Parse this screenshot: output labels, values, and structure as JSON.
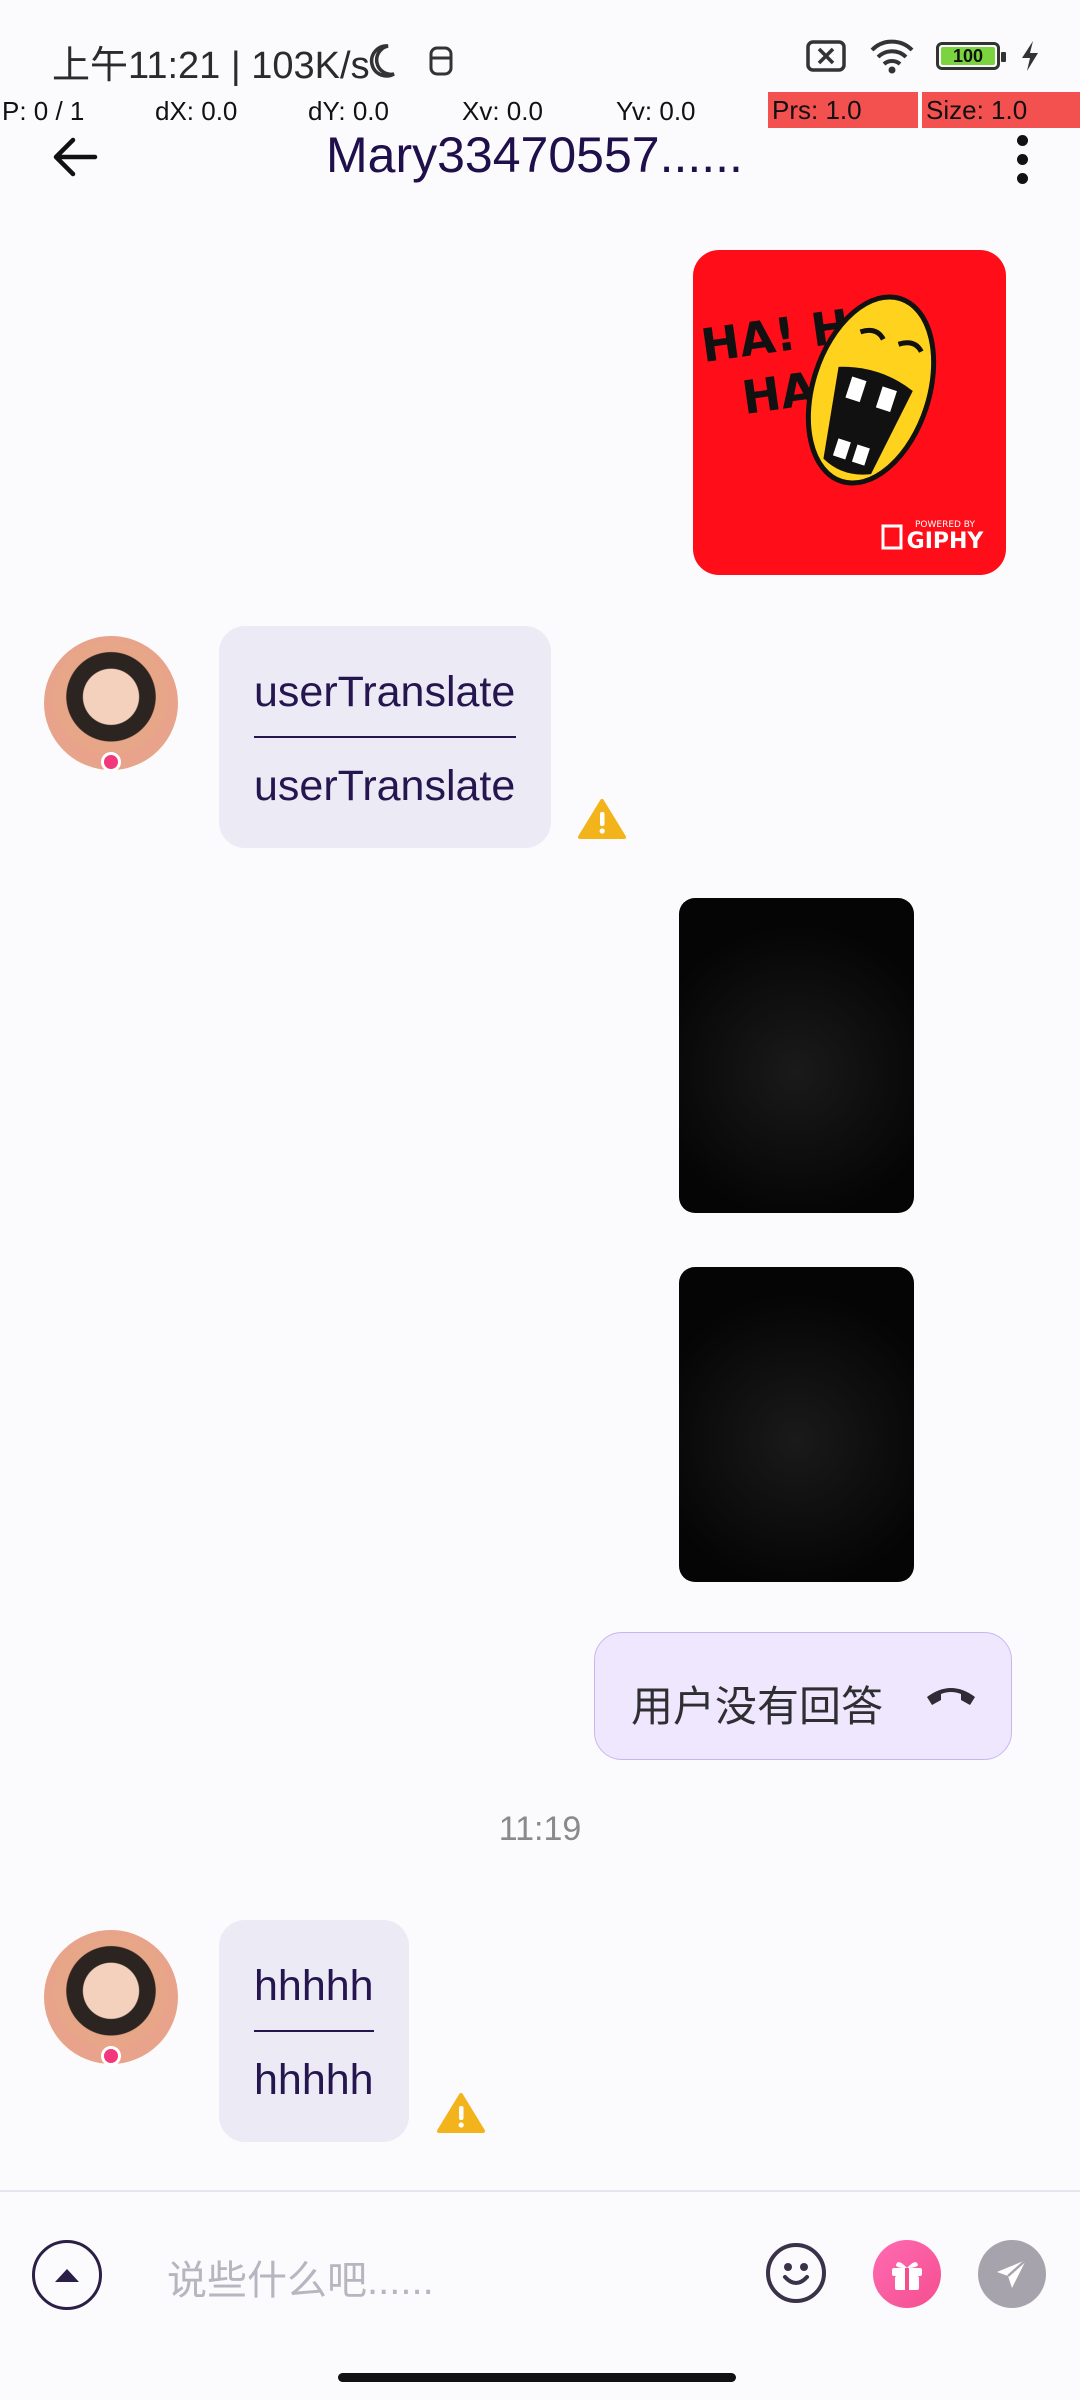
{
  "status_bar": {
    "text": "上午11:21 | 103K/s",
    "battery_level": "100"
  },
  "debug": {
    "p": "P: 0 / 1",
    "dx": "dX: 0.0",
    "dy": "dY: 0.0",
    "xv": "Xv: 0.0",
    "yv": "Yv: 0.0",
    "prs": "Prs: 1.0",
    "size": "Size: 1.0"
  },
  "header": {
    "title": "Mary33470557......"
  },
  "messages": {
    "giphy_text_1": "HA! HA!",
    "giphy_text_2": "HA!",
    "giphy_brand": "GIPHY",
    "giphy_powered": "POWERED BY",
    "msg1_line1": "userTranslate",
    "msg1_line2": "userTranslate",
    "call_text": "用户没有回答",
    "time": "11:19",
    "msg2_line1": "hhhhh",
    "msg2_line2": "hhhhh"
  },
  "input": {
    "placeholder": "说些什么吧......"
  },
  "colors": {
    "accent": "#1f0f4a",
    "warning": "#f3b41b",
    "gift": "#f54e8f",
    "call_bubble": "#efe7fd"
  }
}
